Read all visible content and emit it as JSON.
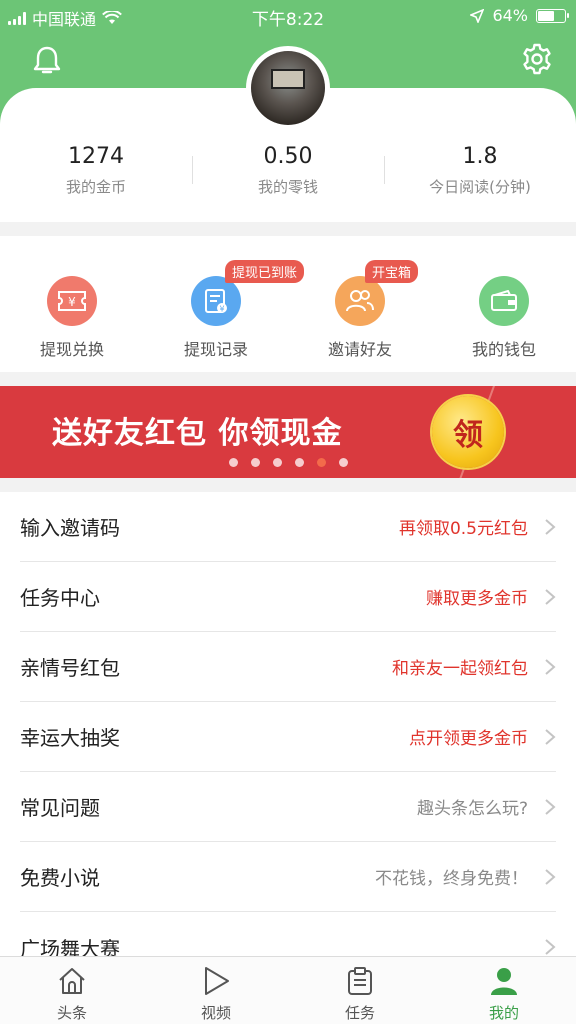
{
  "status_bar": {
    "carrier": "中国联通",
    "time": "下午8:22",
    "battery": "64%",
    "battery_level": 0.64
  },
  "stats": [
    {
      "value": "1274",
      "label": "我的金币"
    },
    {
      "value": "0.50",
      "label": "我的零钱"
    },
    {
      "value": "1.8",
      "label": "今日阅读(分钟)"
    }
  ],
  "shortcuts": [
    {
      "label": "提现兑换",
      "icon": "ticket-yuan-icon",
      "color": "#f07a6c",
      "badge": ""
    },
    {
      "label": "提现记录",
      "icon": "record-icon",
      "color": "#5aa8f0",
      "badge": "提现已到账"
    },
    {
      "label": "邀请好友",
      "icon": "friends-icon",
      "color": "#f5a65b",
      "badge": "开宝箱"
    },
    {
      "label": "我的钱包",
      "icon": "wallet-icon",
      "color": "#74cf84",
      "badge": ""
    }
  ],
  "banner": {
    "text": "送好友红包 你领现金",
    "coin": "领",
    "dot_count": 6,
    "active_dot": 4
  },
  "menu": [
    {
      "title": "输入邀请码",
      "hint": "再领取0.5元红包",
      "hint_color": "#e0342c"
    },
    {
      "title": "任务中心",
      "hint": "赚取更多金币",
      "hint_color": "#e0342c"
    },
    {
      "title": "亲情号红包",
      "hint": "和亲友一起领红包",
      "hint_color": "#e0342c"
    },
    {
      "title": "幸运大抽奖",
      "hint": "点开领更多金币",
      "hint_color": "#e0342c"
    },
    {
      "title": "常见问题",
      "hint": "趣头条怎么玩?",
      "hint_color": "#8a8a8a"
    },
    {
      "title": "免费小说",
      "hint": "不花钱，终身免费！",
      "hint_color": "#8a8a8a"
    },
    {
      "title": "广场舞大赛",
      "hint": "",
      "hint_color": "#8a8a8a"
    }
  ],
  "tabs": [
    {
      "label": "头条",
      "icon": "home-icon"
    },
    {
      "label": "视频",
      "icon": "play-icon"
    },
    {
      "label": "任务",
      "icon": "clipboard-icon"
    },
    {
      "label": "我的",
      "icon": "profile-icon",
      "active": true
    }
  ],
  "colors": {
    "brand_green": "#6cc576",
    "active_tab": "#3a9f48",
    "banner_red": "#d93a3f"
  }
}
